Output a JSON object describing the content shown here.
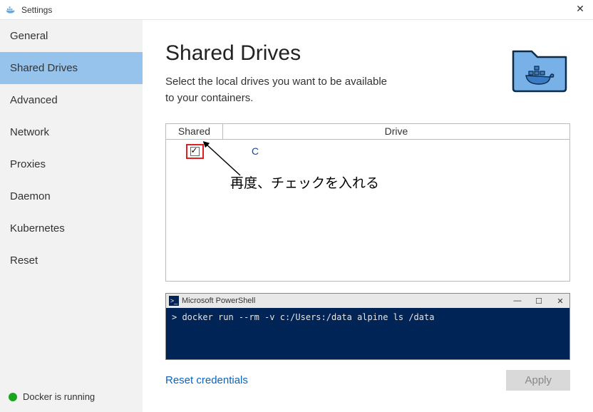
{
  "window": {
    "title": "Settings",
    "close_label": "✕"
  },
  "sidebar": {
    "items": [
      {
        "label": "General"
      },
      {
        "label": "Shared Drives"
      },
      {
        "label": "Advanced"
      },
      {
        "label": "Network"
      },
      {
        "label": "Proxies"
      },
      {
        "label": "Daemon"
      },
      {
        "label": "Kubernetes"
      },
      {
        "label": "Reset"
      }
    ],
    "active_index": 1,
    "status_text": "Docker is running"
  },
  "page": {
    "title": "Shared Drives",
    "description": "Select the local drives you want to be available to your containers."
  },
  "drives_table": {
    "col_shared": "Shared",
    "col_drive": "Drive",
    "rows": [
      {
        "checked": true,
        "drive": "C"
      }
    ]
  },
  "annotation": {
    "text": "再度、チェックを入れる"
  },
  "terminal": {
    "title": "Microsoft PowerShell",
    "controls": {
      "min": "—",
      "max": "☐",
      "close": "✕"
    },
    "command": "> docker run --rm -v c:/Users:/data alpine ls /data"
  },
  "footer": {
    "reset_credentials": "Reset credentials",
    "apply": "Apply"
  }
}
